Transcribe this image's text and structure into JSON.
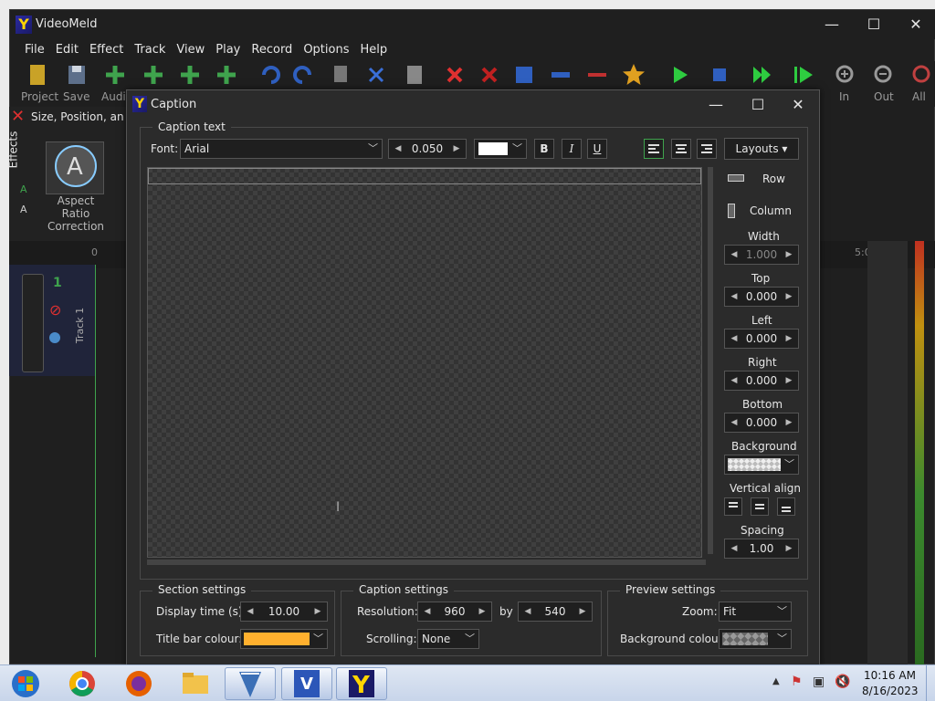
{
  "app": {
    "title": "VideoMeld",
    "logo": "Y"
  },
  "menu": [
    "File",
    "Edit",
    "Effect",
    "Track",
    "View",
    "Play",
    "Record",
    "Options",
    "Help"
  ],
  "toolbar": {
    "labels": {
      "project": "Project",
      "save": "Save",
      "audio": "Audi",
      "zoom_in": "In",
      "zoom_out": "Out",
      "all": "All"
    }
  },
  "left_panel": {
    "tab_effects": "Effects",
    "effect_title": "Size, Position, an",
    "effect_name": "Aspect Ratio Correction",
    "track_name": "Track 1",
    "track_number": "1"
  },
  "timeline": {
    "start": "0",
    "end_mark": "5:0"
  },
  "dialog": {
    "title": "Caption",
    "caption_text_group": "Caption text",
    "font_label": "Font:",
    "font_value": "Arial",
    "size_value": "0.050",
    "text_color": "#ffffff",
    "bold": "B",
    "italic": "I",
    "underline": "U",
    "layouts_label": "Layouts",
    "row_label": "Row",
    "column_label": "Column",
    "width_label": "Width",
    "width_value": "1.000",
    "top_label": "Top",
    "top_value": "0.000",
    "left_label": "Left",
    "left_value": "0.000",
    "right_label": "Right",
    "right_value": "0.000",
    "bottom_label": "Bottom",
    "bottom_value": "0.000",
    "background_label": "Background",
    "valign_label": "Vertical align",
    "spacing_label": "Spacing",
    "spacing_value": "1.00",
    "section": {
      "title": "Section settings",
      "display_time_label": "Display time (s):",
      "display_time_value": "10.00",
      "title_bar_colour_label": "Title bar colour:",
      "title_bar_colour": "#ffb02e"
    },
    "caption": {
      "title": "Caption settings",
      "resolution_label": "Resolution:",
      "res_w": "960",
      "by_label": "by",
      "res_h": "540",
      "scrolling_label": "Scrolling:",
      "scrolling_value": "None"
    },
    "preview": {
      "title": "Preview settings",
      "zoom_label": "Zoom:",
      "zoom_value": "Fit",
      "bg_colour_label": "Background colour:"
    }
  },
  "taskbar": {
    "time": "10:16 AM",
    "date": "8/16/2023"
  },
  "colors": {
    "accent": "#3fa34d",
    "play": "#2ecc40",
    "stop": "#e03030"
  }
}
